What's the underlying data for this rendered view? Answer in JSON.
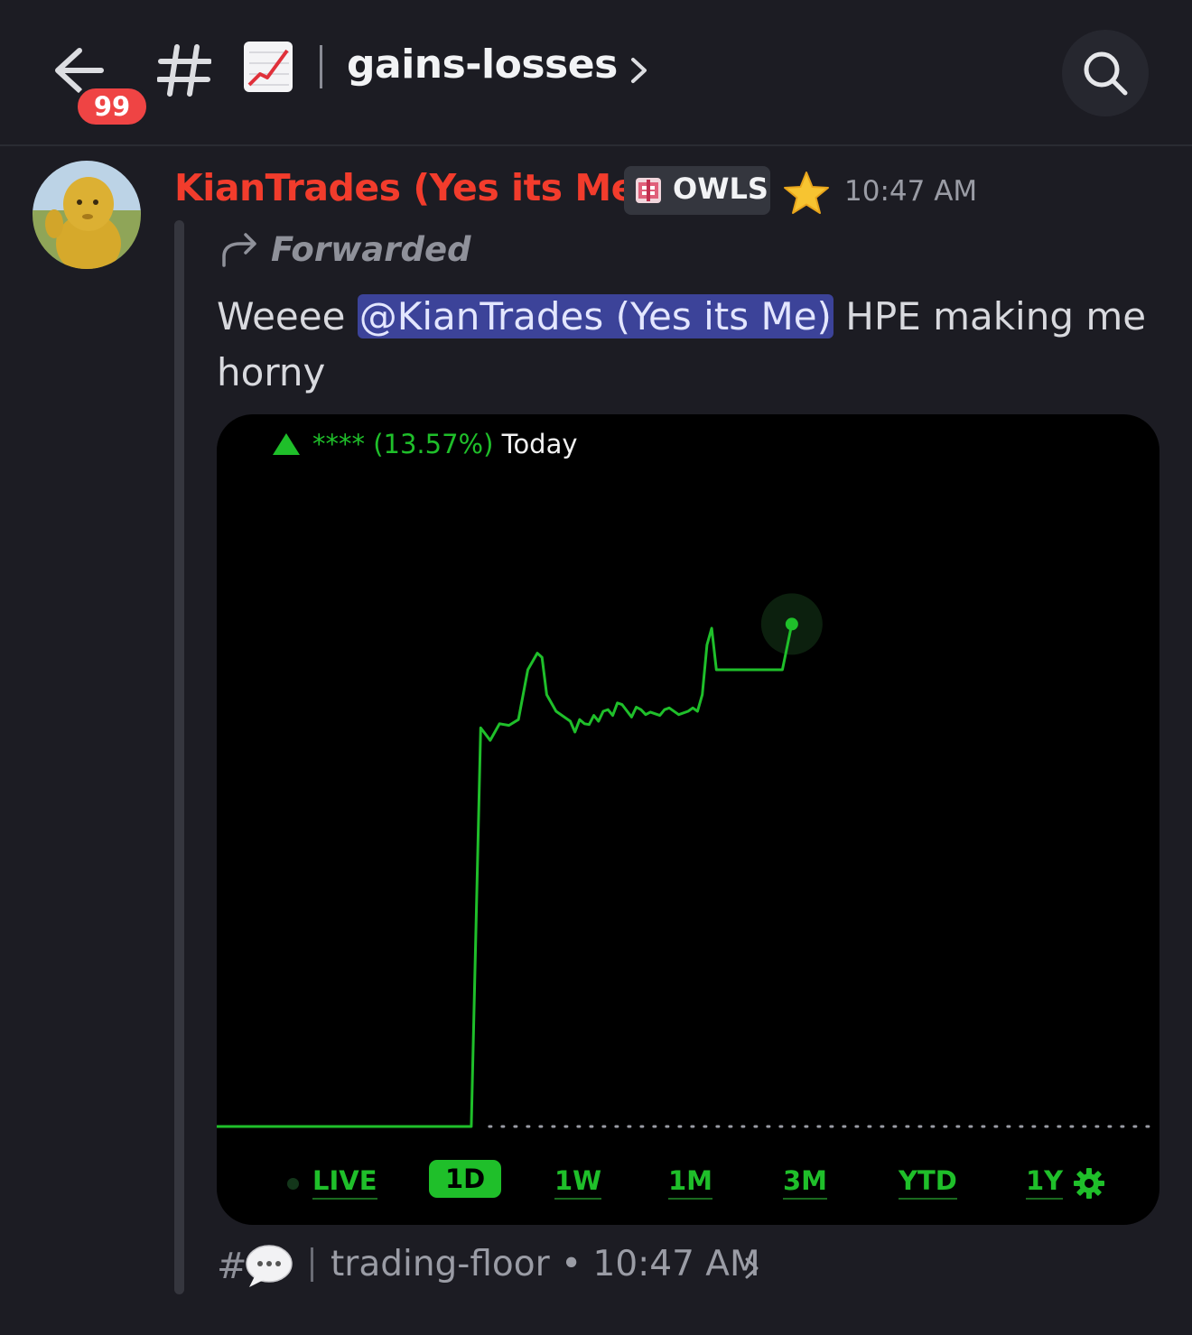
{
  "header": {
    "unread_count": "99",
    "channel_name": "gains-losses",
    "icons": [
      "back-arrow-icon",
      "hash-icon",
      "chart-increasing-emoji",
      "chevron-right-icon",
      "search-icon"
    ]
  },
  "message": {
    "username": "KianTrades (Yes its Me)",
    "username_color": "#f23c2c",
    "role_tag": "OWLS",
    "time": "10:47 AM",
    "forwarded_label": "Forwarded",
    "text_before": "Weeee ",
    "mention": "@KianTrades (Yes its Me)",
    "text_after": " HPE making me horny"
  },
  "embed": {
    "stars": "****",
    "change_pct": "(13.57%)",
    "period": "Today",
    "accent_color": "#1fbf2a",
    "ranges": [
      "LIVE",
      "1D",
      "1W",
      "1M",
      "3M",
      "YTD",
      "1Y"
    ],
    "active_range": "1D"
  },
  "chart_data": {
    "type": "line",
    "title": "",
    "xlabel": "",
    "ylabel": "",
    "x": [
      0,
      0.27,
      0.28,
      0.29,
      0.3,
      0.31,
      0.32,
      0.33,
      0.34,
      0.345,
      0.35,
      0.36,
      0.37,
      0.375,
      0.38,
      0.385,
      0.39,
      0.395,
      0.4,
      0.405,
      0.41,
      0.415,
      0.42,
      0.425,
      0.43,
      0.44,
      0.445,
      0.45,
      0.455,
      0.46,
      0.47,
      0.475,
      0.48,
      0.49,
      0.5,
      0.505,
      0.51,
      0.515,
      0.52,
      0.525,
      0.53,
      0.54,
      0.55,
      0.56,
      0.57,
      0.58,
      0.59,
      0.6,
      0.61
    ],
    "y": [
      0,
      0,
      4.8,
      4.65,
      4.85,
      4.83,
      4.9,
      5.5,
      5.7,
      5.65,
      5.2,
      5.0,
      4.92,
      4.88,
      4.75,
      4.9,
      4.85,
      4.84,
      4.95,
      4.88,
      5.0,
      5.02,
      4.95,
      5.1,
      5.08,
      4.93,
      5.05,
      5.02,
      4.96,
      4.99,
      4.95,
      5.02,
      5.04,
      4.96,
      5.0,
      5.04,
      5.0,
      5.2,
      5.8,
      6.0,
      5.5,
      5.5,
      5.5,
      5.5,
      5.5,
      5.5,
      5.5,
      5.5,
      6.05
    ],
    "baseline": 0,
    "end_value_marker": true,
    "grid": false,
    "legend": "none"
  },
  "footer": {
    "source_channel": "trading-floor",
    "separator": "•",
    "source_time": "10:47 AM"
  }
}
